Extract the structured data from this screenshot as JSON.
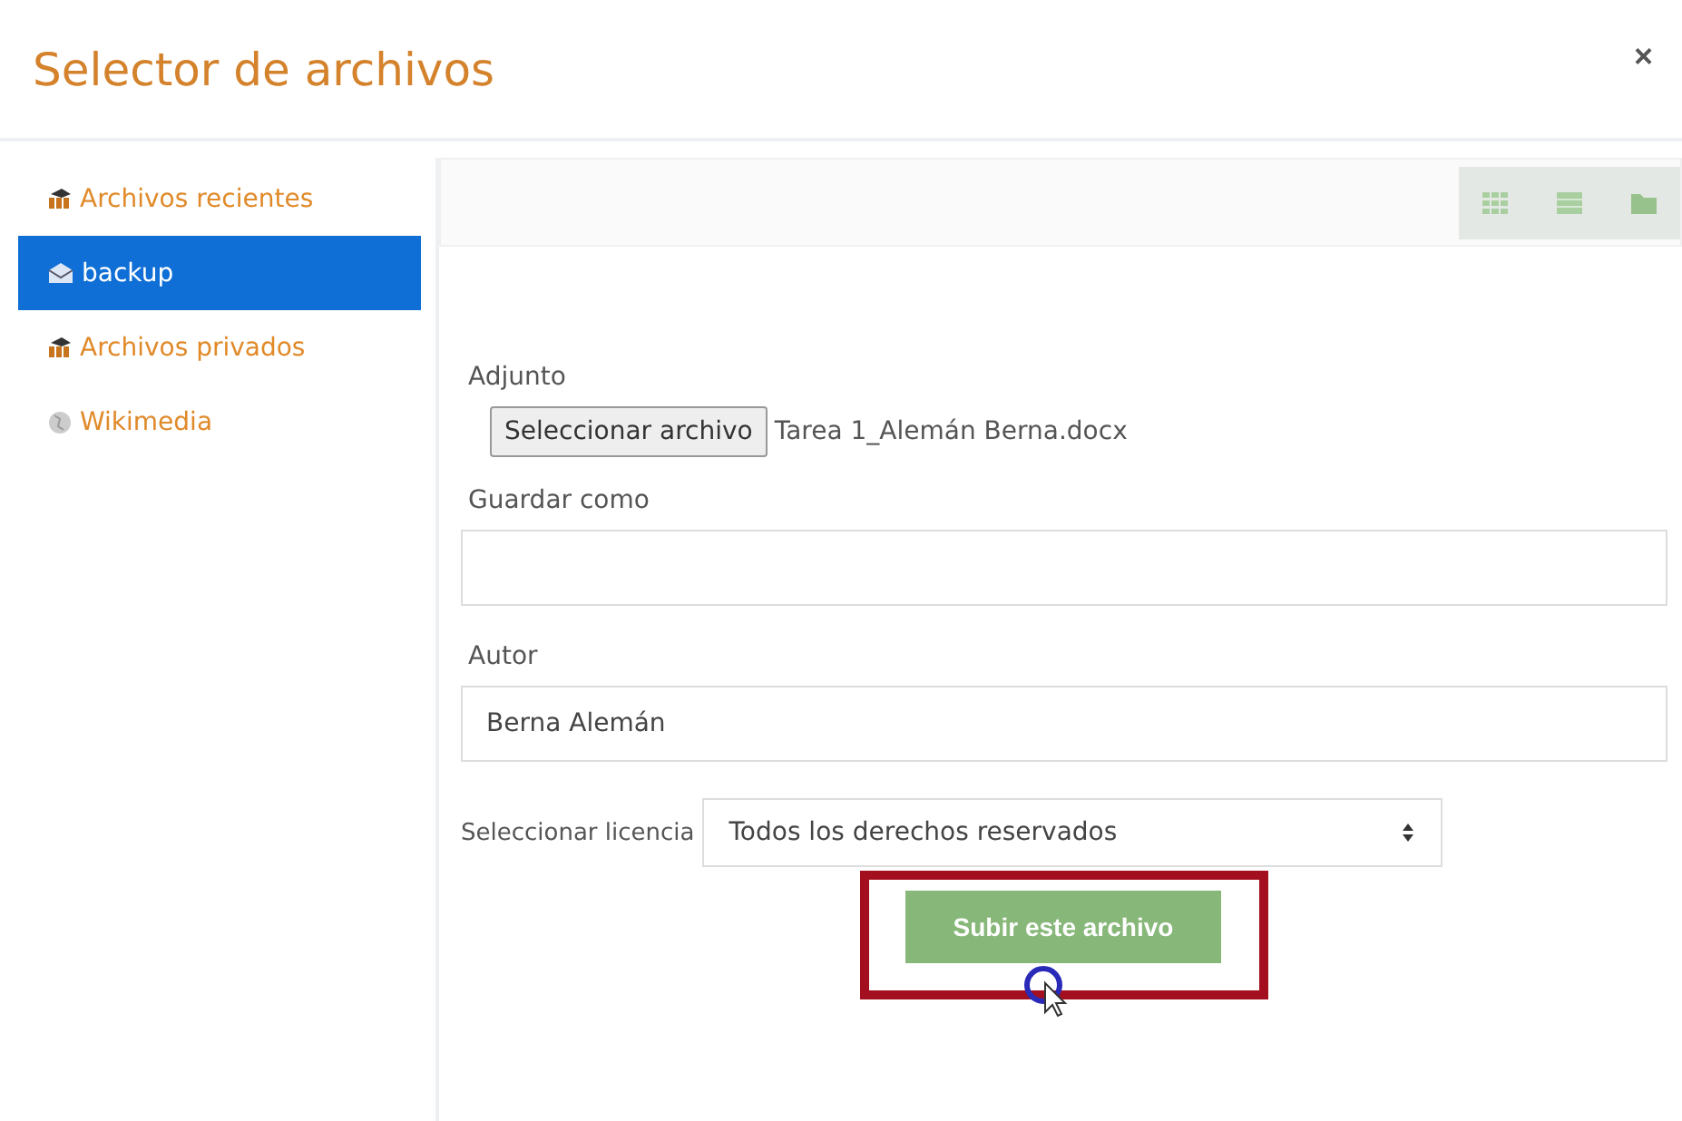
{
  "dialog": {
    "title": "Selector de archivos",
    "close": "×"
  },
  "repositories": [
    {
      "label": "Archivos recientes",
      "kind": "course",
      "selected": false
    },
    {
      "label": "backup",
      "kind": "archive",
      "selected": true
    },
    {
      "label": "Archivos privados",
      "kind": "course",
      "selected": false
    },
    {
      "label": "Wikimedia",
      "kind": "web",
      "selected": false
    }
  ],
  "form": {
    "attachment_label": "Adjunto",
    "choose_button": "Seleccionar archivo",
    "chosen_file": "Tarea 1_Alemán Berna.docx",
    "save_as_label": "Guardar como",
    "author_label": "Autor",
    "author_value": "Berna Alemán",
    "license_label": "Seleccionar licencia",
    "license_value": "Todos los derechos reservados",
    "submit": "Subir este archivo"
  }
}
